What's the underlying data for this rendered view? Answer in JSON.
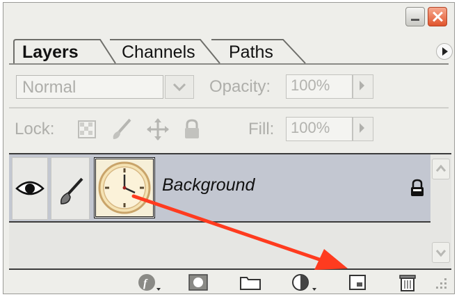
{
  "tabs": [
    {
      "label": "Layers",
      "active": true
    },
    {
      "label": "Channels",
      "active": false
    },
    {
      "label": "Paths",
      "active": false
    }
  ],
  "blend_mode": {
    "value": "Normal"
  },
  "opacity": {
    "label": "Opacity:",
    "value": "100%"
  },
  "lock": {
    "label": "Lock:"
  },
  "fill": {
    "label": "Fill:",
    "value": "100%"
  },
  "layers": [
    {
      "name": "Background",
      "visible": true,
      "locked": true
    }
  ],
  "annotation": {
    "color": "#ff3b1f"
  },
  "colors": {
    "panel_bg": "#eeeeea",
    "layer_selected_bg": "#c3c7d1",
    "close_button": "#e0542c"
  }
}
